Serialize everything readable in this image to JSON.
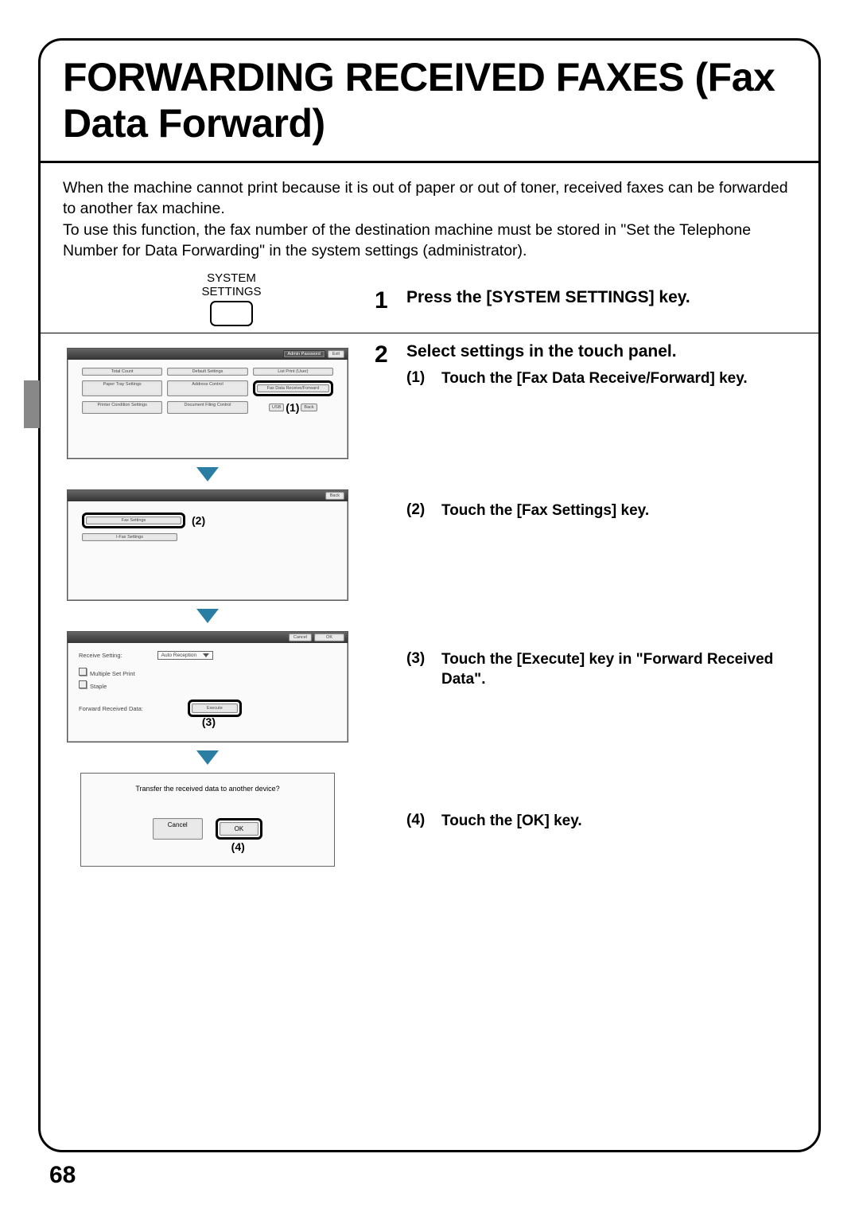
{
  "page_title": "FORWARDING RECEIVED FAXES (Fax Data Forward)",
  "intro": "When the machine cannot print because it is out of paper or out of toner, received faxes can be forwarded to another fax machine.\nTo use this function, the fax number of the destination machine must be stored in \"Set the Telephone Number for Data Forwarding\" in the system settings (administrator).",
  "step1": {
    "num": "1",
    "heading": "Press the [SYSTEM SETTINGS] key.",
    "key_label_line1": "SYSTEM",
    "key_label_line2": "SETTINGS"
  },
  "step2": {
    "num": "2",
    "heading": "Select settings in the touch panel.",
    "sub1_label": "(1)",
    "sub1_text": "Touch the [Fax Data Receive/Forward] key.",
    "sub2_label": "(2)",
    "sub2_text": "Touch the [Fax Settings] key.",
    "sub3_label": "(3)",
    "sub3_text": "Touch the [Execute] key in \"Forward Received Data\".",
    "sub4_label": "(4)",
    "sub4_text": "Touch the [OK] key."
  },
  "panel1": {
    "admin_pw": "Admin Password",
    "exit": "Exit",
    "total_count": "Total Count",
    "default_settings": "Default Settings",
    "list_print": "List Print (User)",
    "paper_tray": "Paper Tray Settings",
    "address_control": "Address Control",
    "fax_data": "Fax Data Receive/Forward",
    "printer_cond": "Printer Condition Settings",
    "doc_filing": "Document Filing Control",
    "usb": "USB",
    "back": "Back",
    "callout": "(1)"
  },
  "panel2": {
    "back": "Back",
    "fax_settings": "Fax Settings",
    "ifax_settings": "I-Fax Settings",
    "callout": "(2)"
  },
  "panel3": {
    "cancel": "Cancel",
    "ok": "OK",
    "recv_setting": "Receive Setting:",
    "auto_reception": "Auto Reception",
    "multi_set": "Multiple Set Print",
    "staple": "Staple",
    "fwd_label": "Forward Received Data:",
    "execute": "Execute",
    "callout": "(3)"
  },
  "panel4": {
    "question": "Transfer the received data to another device?",
    "cancel": "Cancel",
    "ok": "OK",
    "callout": "(4)"
  },
  "page_number": "68"
}
